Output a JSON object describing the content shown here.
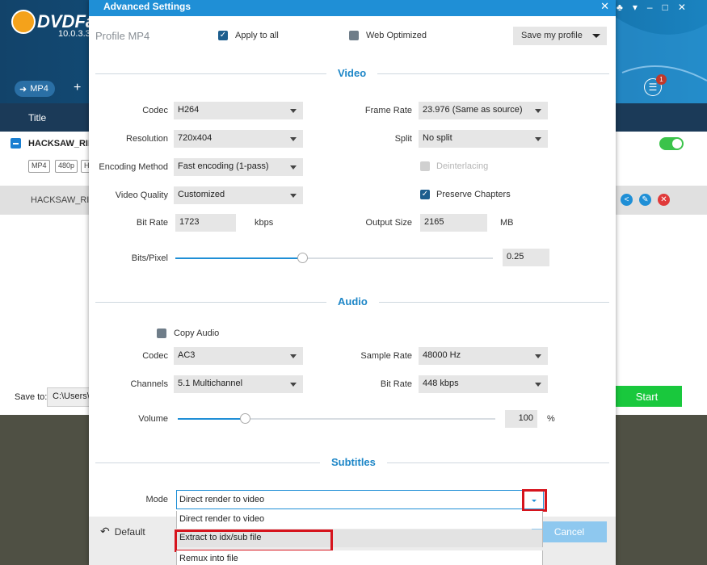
{
  "app": {
    "logo": "DVDFab",
    "version": "10.0.3.3",
    "mode_button": "MP4",
    "add_label": "+",
    "title_column": "Title",
    "movie_title": "HACKSAW_RIDG",
    "tags": [
      "MP4",
      "480p",
      "H"
    ],
    "movie_subtitle": "HACKSAW_RID",
    "save_to_label": "Save to:",
    "save_path": "C:\\Users\\",
    "start_button": "Start",
    "queue_badge": "1",
    "window_controls": [
      "♣",
      "▾",
      "–",
      "□",
      "✕"
    ]
  },
  "dialog": {
    "title": "Advanced Settings",
    "close": "✕",
    "profile": "Profile  MP4",
    "apply_to_all": "Apply to all",
    "web_optimized": "Web Optimized",
    "save_profile": "Save my profile",
    "sections": {
      "video": "Video",
      "audio": "Audio",
      "subtitles": "Subtitles"
    },
    "video": {
      "codec_label": "Codec",
      "codec": "H264",
      "resolution_label": "Resolution",
      "resolution": "720x404",
      "encoding_label": "Encoding Method",
      "encoding": "Fast encoding (1-pass)",
      "quality_label": "Video Quality",
      "quality": "Customized",
      "bitrate_label": "Bit Rate",
      "bitrate": "1723",
      "bitrate_unit": "kbps",
      "framerate_label": "Frame Rate",
      "framerate": "23.976 (Same as source)",
      "split_label": "Split",
      "split": "No split",
      "deinterlacing": "Deinterlacing",
      "preserve_chapters": "Preserve Chapters",
      "outputsize_label": "Output Size",
      "outputsize": "2165",
      "outputsize_unit": "MB",
      "bitspixel_label": "Bits/Pixel",
      "bitspixel": "0.25",
      "bitspixel_level": 0.4
    },
    "audio": {
      "copy_audio": "Copy Audio",
      "codec_label": "Codec",
      "codec": "AC3",
      "channels_label": "Channels",
      "channels": "5.1 Multichannel",
      "samplerate_label": "Sample Rate",
      "samplerate": "48000 Hz",
      "bitrate_label": "Bit Rate",
      "bitrate": "448 kbps",
      "volume_label": "Volume",
      "volume": "100",
      "volume_unit": "%",
      "volume_level": 0.21
    },
    "subtitles": {
      "mode_label": "Mode",
      "mode": "Direct render to video",
      "options": [
        "Direct render to video",
        "Extract to idx/sub file",
        "Remux into file"
      ]
    },
    "default_button": "Default",
    "cancel_button": "Cancel"
  },
  "colors": {
    "accent": "#1f8fd6",
    "highlight": "#d6141d",
    "start": "#19c83d"
  }
}
